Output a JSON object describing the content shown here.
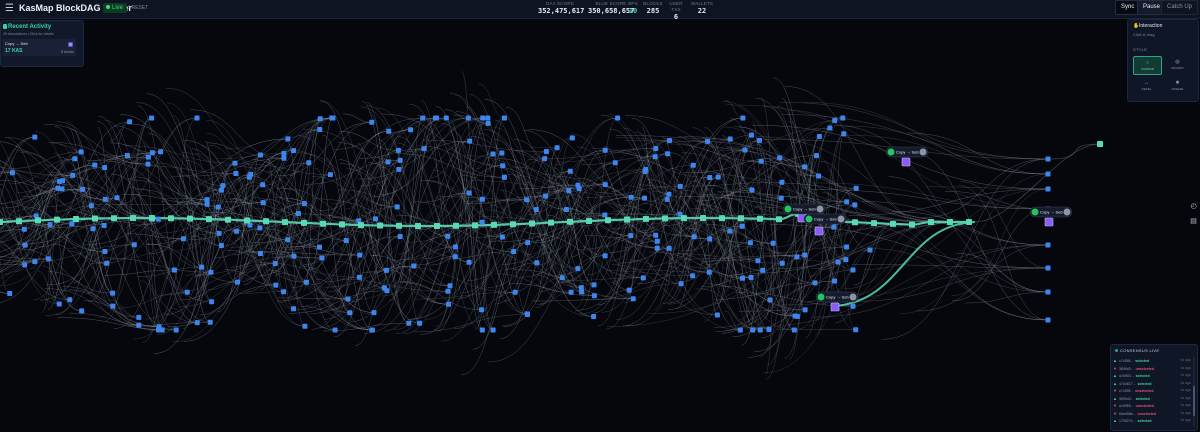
{
  "header": {
    "title": "KasMap BlockDAG Viewer",
    "live_label": "Live",
    "reset_label": "RESET",
    "stats": [
      {
        "label": "DAA SCORE",
        "value": "352,475,617"
      },
      {
        "label": "BLUE SCORE",
        "value": "350,658,657"
      },
      {
        "label": "BPS",
        "value": "10"
      },
      {
        "label": "BLOCKS",
        "value": "285"
      },
      {
        "label": "USER TXS",
        "value": "6"
      },
      {
        "label": "WALLETS",
        "value": "22"
      }
    ],
    "buttons": {
      "sync": "Sync",
      "pause": "Pause",
      "catchup": "Catch Up"
    }
  },
  "activity": {
    "title": "Recent Activity",
    "subtitle": "26 transactions • Click for details",
    "card": {
      "title": "Copy → Seb",
      "value": "17 KAS",
      "time": "8 blocks"
    }
  },
  "interaction": {
    "title": "Interaction",
    "subtitle": "Click & drag",
    "style_label": "STYLE",
    "modes": [
      {
        "label": "CURSOR",
        "active": true
      },
      {
        "label": "MAGNET",
        "active": false
      },
      {
        "label": "REPEL",
        "active": false
      },
      {
        "label": "FREEZE",
        "active": false
      }
    ]
  },
  "tx_labels": [
    "Copy → Seb",
    "Copy → Seb",
    "Copy → Seb",
    "Copy → Seb",
    "Copy → Seb"
  ],
  "consensus": {
    "title": "CONSENSUS LIVE",
    "rows": [
      {
        "hash": "c7c398...",
        "state": "selected",
        "dir": "up",
        "time": "0s ago"
      },
      {
        "hash": "3f0f9d3...",
        "state": "unselected",
        "dir": "down",
        "time": "0s ago"
      },
      {
        "hash": "a1f4f03...",
        "state": "selected",
        "dir": "up",
        "time": "0s ago"
      },
      {
        "hash": "47d4617...",
        "state": "selected",
        "dir": "up",
        "time": "0s ago"
      },
      {
        "hash": "c7c398...",
        "state": "unselected",
        "dir": "down",
        "time": "0s ago"
      },
      {
        "hash": "3f0f9d3...",
        "state": "selected",
        "dir": "up",
        "time": "0s ago"
      },
      {
        "hash": "a1f0f55...",
        "state": "unselected",
        "dir": "down",
        "time": "0s ago"
      },
      {
        "hash": "8da498a...",
        "state": "unselected",
        "dir": "down",
        "time": "0s ago"
      },
      {
        "hash": "1739274...",
        "state": "selected",
        "dir": "up",
        "time": "0s ago"
      }
    ]
  },
  "colors": {
    "block": "#3d86f0",
    "chain": "#59d9b4",
    "tx_block": "#8b5cf6",
    "edge": "#9aa3b5",
    "background": "#05070c"
  }
}
